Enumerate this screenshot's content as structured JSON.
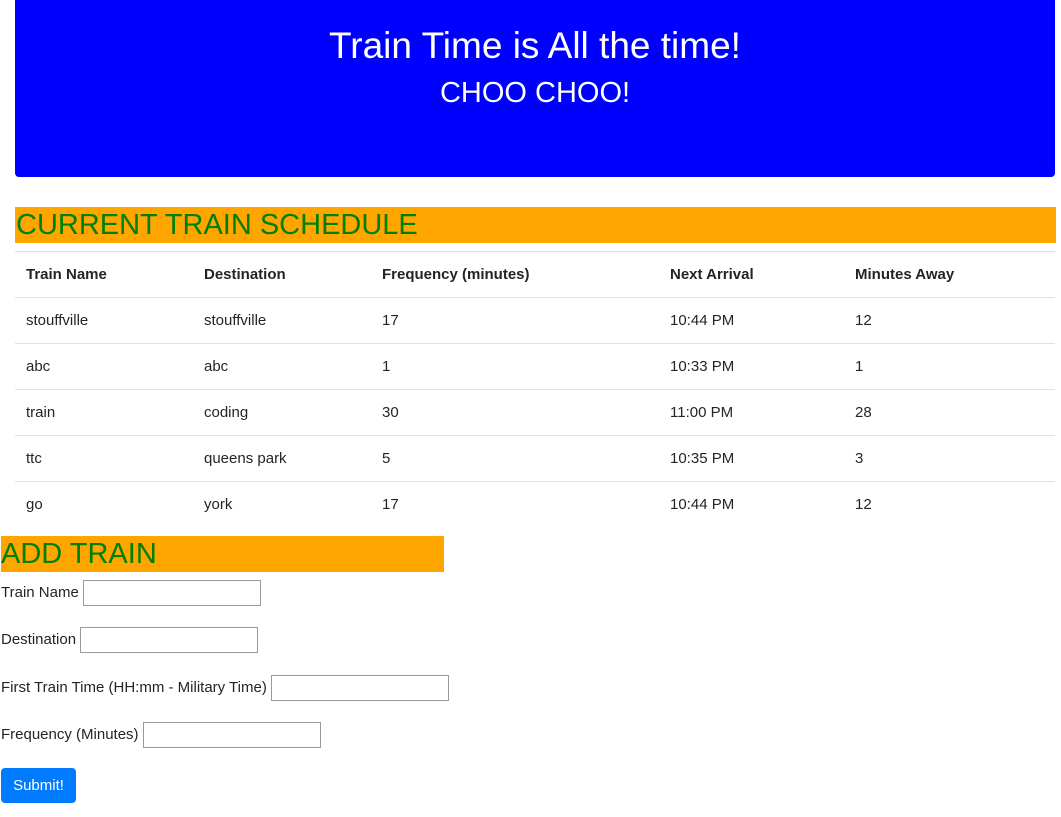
{
  "header": {
    "title": "Train Time is All the time!",
    "subtitle": "CHOO CHOO!"
  },
  "schedule": {
    "heading": "CURRENT TRAIN SCHEDULE",
    "columns": [
      "Train Name",
      "Destination",
      "Frequency (minutes)",
      "Next Arrival",
      "Minutes Away"
    ],
    "rows": [
      [
        "stouffville",
        "stouffville",
        "17",
        "10:44 PM",
        "12"
      ],
      [
        "abc",
        "abc",
        "1",
        "10:33 PM",
        "1"
      ],
      [
        "train",
        "coding",
        "30",
        "11:00 PM",
        "28"
      ],
      [
        "ttc",
        "queens park",
        "5",
        "10:35 PM",
        "3"
      ],
      [
        "go",
        "york",
        "17",
        "10:44 PM",
        "12"
      ]
    ]
  },
  "form": {
    "heading": "ADD TRAIN",
    "train_name_label": "Train Name",
    "train_name_value": "",
    "destination_label": "Destination",
    "destination_value": "",
    "first_time_label": "First Train Time (HH:mm - Military Time)",
    "first_time_value": "",
    "frequency_label": "Frequency (Minutes)",
    "frequency_value": "",
    "submit_label": "Submit!"
  },
  "colors": {
    "jumbotron_bg": "#0000ff",
    "section_bg": "#ffa500",
    "section_text": "#008000",
    "button_bg": "#007bff"
  }
}
